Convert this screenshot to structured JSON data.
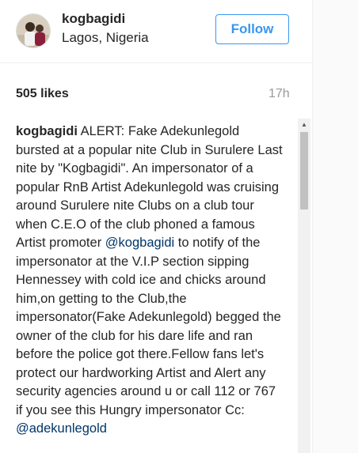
{
  "header": {
    "username": "kogbagidi",
    "location": "Lagos, Nigeria",
    "follow_label": "Follow",
    "avatar_icon": "user-avatar-photo"
  },
  "stats": {
    "likes": "505 likes",
    "time": "17h"
  },
  "caption": {
    "username": "kogbagidi",
    "text_1": "ALERT: Fake Adekunlegold bursted at a popular nite Club in Surulere Last nite by \"Kogbagidi\". An impersonator of a popular RnB Artist Adekunlegold was cruising around Surulere nite Clubs on a club tour when C.E.O of the club phoned a famous Artist promoter",
    "mention_1": "@kogbagidi",
    "text_2": "to notify of the impersonator at the V.I.P section sipping Hennessey with cold ice and chicks around him,on getting to the Club,the impersonator(Fake Adekunlegold) begged the owner of the club for his dare life and ran before the police got there.Fellow fans let's protect our hardworking Artist and Alert any security agencies around u or call 112 or 767 if you see this Hungry impersonator Cc:",
    "mention_2": "@adekunlegold"
  },
  "scrollbar": {
    "up_arrow_icon": "scroll-up-arrow-icon"
  },
  "colors": {
    "follow_blue": "#3897f0",
    "mention_blue": "#003569",
    "muted_gray": "#999999",
    "text": "#262626"
  }
}
